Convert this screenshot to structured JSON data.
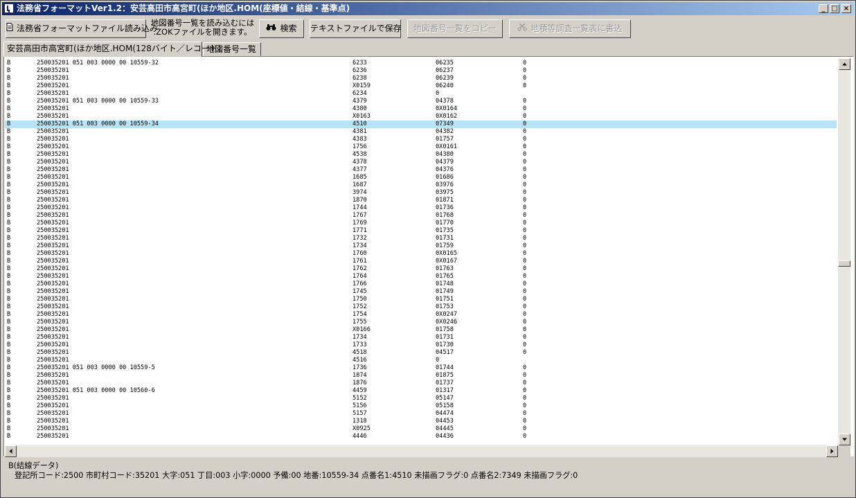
{
  "window": {
    "title": "法務省フォーマットVer1.2：安芸高田市高宮町(ほか地区.HOM(座標値・結線・基準点)",
    "min_label": "_",
    "max_label": "□",
    "close_label": "×"
  },
  "toolbar": {
    "load_label": "法務省フォーマットファイル読み込み",
    "hint_line1": "地図番号一覧を読み込むには",
    "hint_line2": ".ZOKファイルを開きます。",
    "search_label": "検索",
    "save_label": "テキストファイルで保存",
    "copy_label": "地図番号一覧をコピー",
    "write_label": "地積等調査一覧表に書込"
  },
  "tabs": [
    {
      "label": "安芸高田市高宮町(ほか地区.HOM(128バイト／レコード)"
    },
    {
      "label": "地図番号一覧"
    }
  ],
  "rows": [
    [
      "B",
      "250035201 051 003 0000 00 10559-32",
      "6233",
      "06235",
      "0"
    ],
    [
      "B",
      "250035201",
      "6236",
      "06237",
      "0"
    ],
    [
      "B",
      "250035201",
      "6238",
      "06239",
      "0"
    ],
    [
      "B",
      "250035201",
      "X0159",
      "06240",
      "0"
    ],
    [
      "B",
      "250035201",
      "6234",
      "0",
      ""
    ],
    [
      "B",
      "250035201 051 003 0000 00 10559-33",
      "4379",
      "04378",
      "0"
    ],
    [
      "B",
      "250035201",
      "4380",
      "0X0164",
      "0"
    ],
    [
      "B",
      "250035201",
      "X0163",
      "0X0162",
      "0"
    ],
    [
      "B",
      "250035201 051 003 0000 00 10559-34",
      "4510",
      "07349",
      "0"
    ],
    [
      "B",
      "250035201",
      "4381",
      "04382",
      "0"
    ],
    [
      "B",
      "250035201",
      "4383",
      "01757",
      "0"
    ],
    [
      "B",
      "250035201",
      "1756",
      "0X0161",
      "0"
    ],
    [
      "B",
      "250035201",
      "4538",
      "04380",
      "0"
    ],
    [
      "B",
      "250035201",
      "4378",
      "04379",
      "0"
    ],
    [
      "B",
      "250035201",
      "4377",
      "04376",
      "0"
    ],
    [
      "B",
      "250035201",
      "1685",
      "01686",
      "0"
    ],
    [
      "B",
      "250035201",
      "1687",
      "03976",
      "0"
    ],
    [
      "B",
      "250035201",
      "3974",
      "03975",
      "0"
    ],
    [
      "B",
      "250035201",
      "1870",
      "01871",
      "0"
    ],
    [
      "B",
      "250035201",
      "1744",
      "01736",
      "0"
    ],
    [
      "B",
      "250035201",
      "1767",
      "01768",
      "0"
    ],
    [
      "B",
      "250035201",
      "1769",
      "01770",
      "0"
    ],
    [
      "B",
      "250035201",
      "1771",
      "01735",
      "0"
    ],
    [
      "B",
      "250035201",
      "1732",
      "01731",
      "0"
    ],
    [
      "B",
      "250035201",
      "1734",
      "01759",
      "0"
    ],
    [
      "B",
      "250035201",
      "1760",
      "0X0165",
      "0"
    ],
    [
      "B",
      "250035201",
      "1761",
      "0X0167",
      "0"
    ],
    [
      "B",
      "250035201",
      "1762",
      "01763",
      "0"
    ],
    [
      "B",
      "250035201",
      "1764",
      "01765",
      "0"
    ],
    [
      "B",
      "250035201",
      "1766",
      "01748",
      "0"
    ],
    [
      "B",
      "250035201",
      "1745",
      "01749",
      "0"
    ],
    [
      "B",
      "250035201",
      "1750",
      "01751",
      "0"
    ],
    [
      "B",
      "250035201",
      "1752",
      "01753",
      "0"
    ],
    [
      "B",
      "250035201",
      "1754",
      "0X0247",
      "0"
    ],
    [
      "B",
      "250035201",
      "1755",
      "0X0246",
      "0"
    ],
    [
      "B",
      "250035201",
      "X0166",
      "01758",
      "0"
    ],
    [
      "B",
      "250035201",
      "1734",
      "01731",
      "0"
    ],
    [
      "B",
      "250035201",
      "1733",
      "01730",
      "0"
    ],
    [
      "B",
      "250035201",
      "4518",
      "04517",
      "0"
    ],
    [
      "B",
      "250035201",
      "4516",
      "0",
      ""
    ],
    [
      "B",
      "250035201 051 003 0000 00 10559-5",
      "1736",
      "01744",
      "0"
    ],
    [
      "B",
      "250035201",
      "1874",
      "01875",
      "0"
    ],
    [
      "B",
      "250035201",
      "1876",
      "01737",
      "0"
    ],
    [
      "B",
      "250035201 051 003 0000 00 10560-6",
      "4459",
      "01317",
      "0"
    ],
    [
      "B",
      "250035201",
      "5152",
      "05147",
      "0"
    ],
    [
      "B",
      "250035201",
      "5156",
      "05158",
      "0"
    ],
    [
      "B",
      "250035201",
      "5157",
      "04474",
      "0"
    ],
    [
      "B",
      "250035201",
      "1318",
      "04453",
      "0"
    ],
    [
      "B",
      "250035201",
      "X0925",
      "04445",
      "0"
    ],
    [
      "B",
      "250035201",
      "4446",
      "04436",
      "0"
    ]
  ],
  "selected_row": 8,
  "status": {
    "line1": "B(結線データ)",
    "line2": "登記所コード:2500  市町村コード:35201  大字:051  丁目:003  小字:0000  予備:00  地番:10559-34  点番名1:4510  未描画フラグ:0  点番名2:7349  未描画フラグ:0"
  }
}
